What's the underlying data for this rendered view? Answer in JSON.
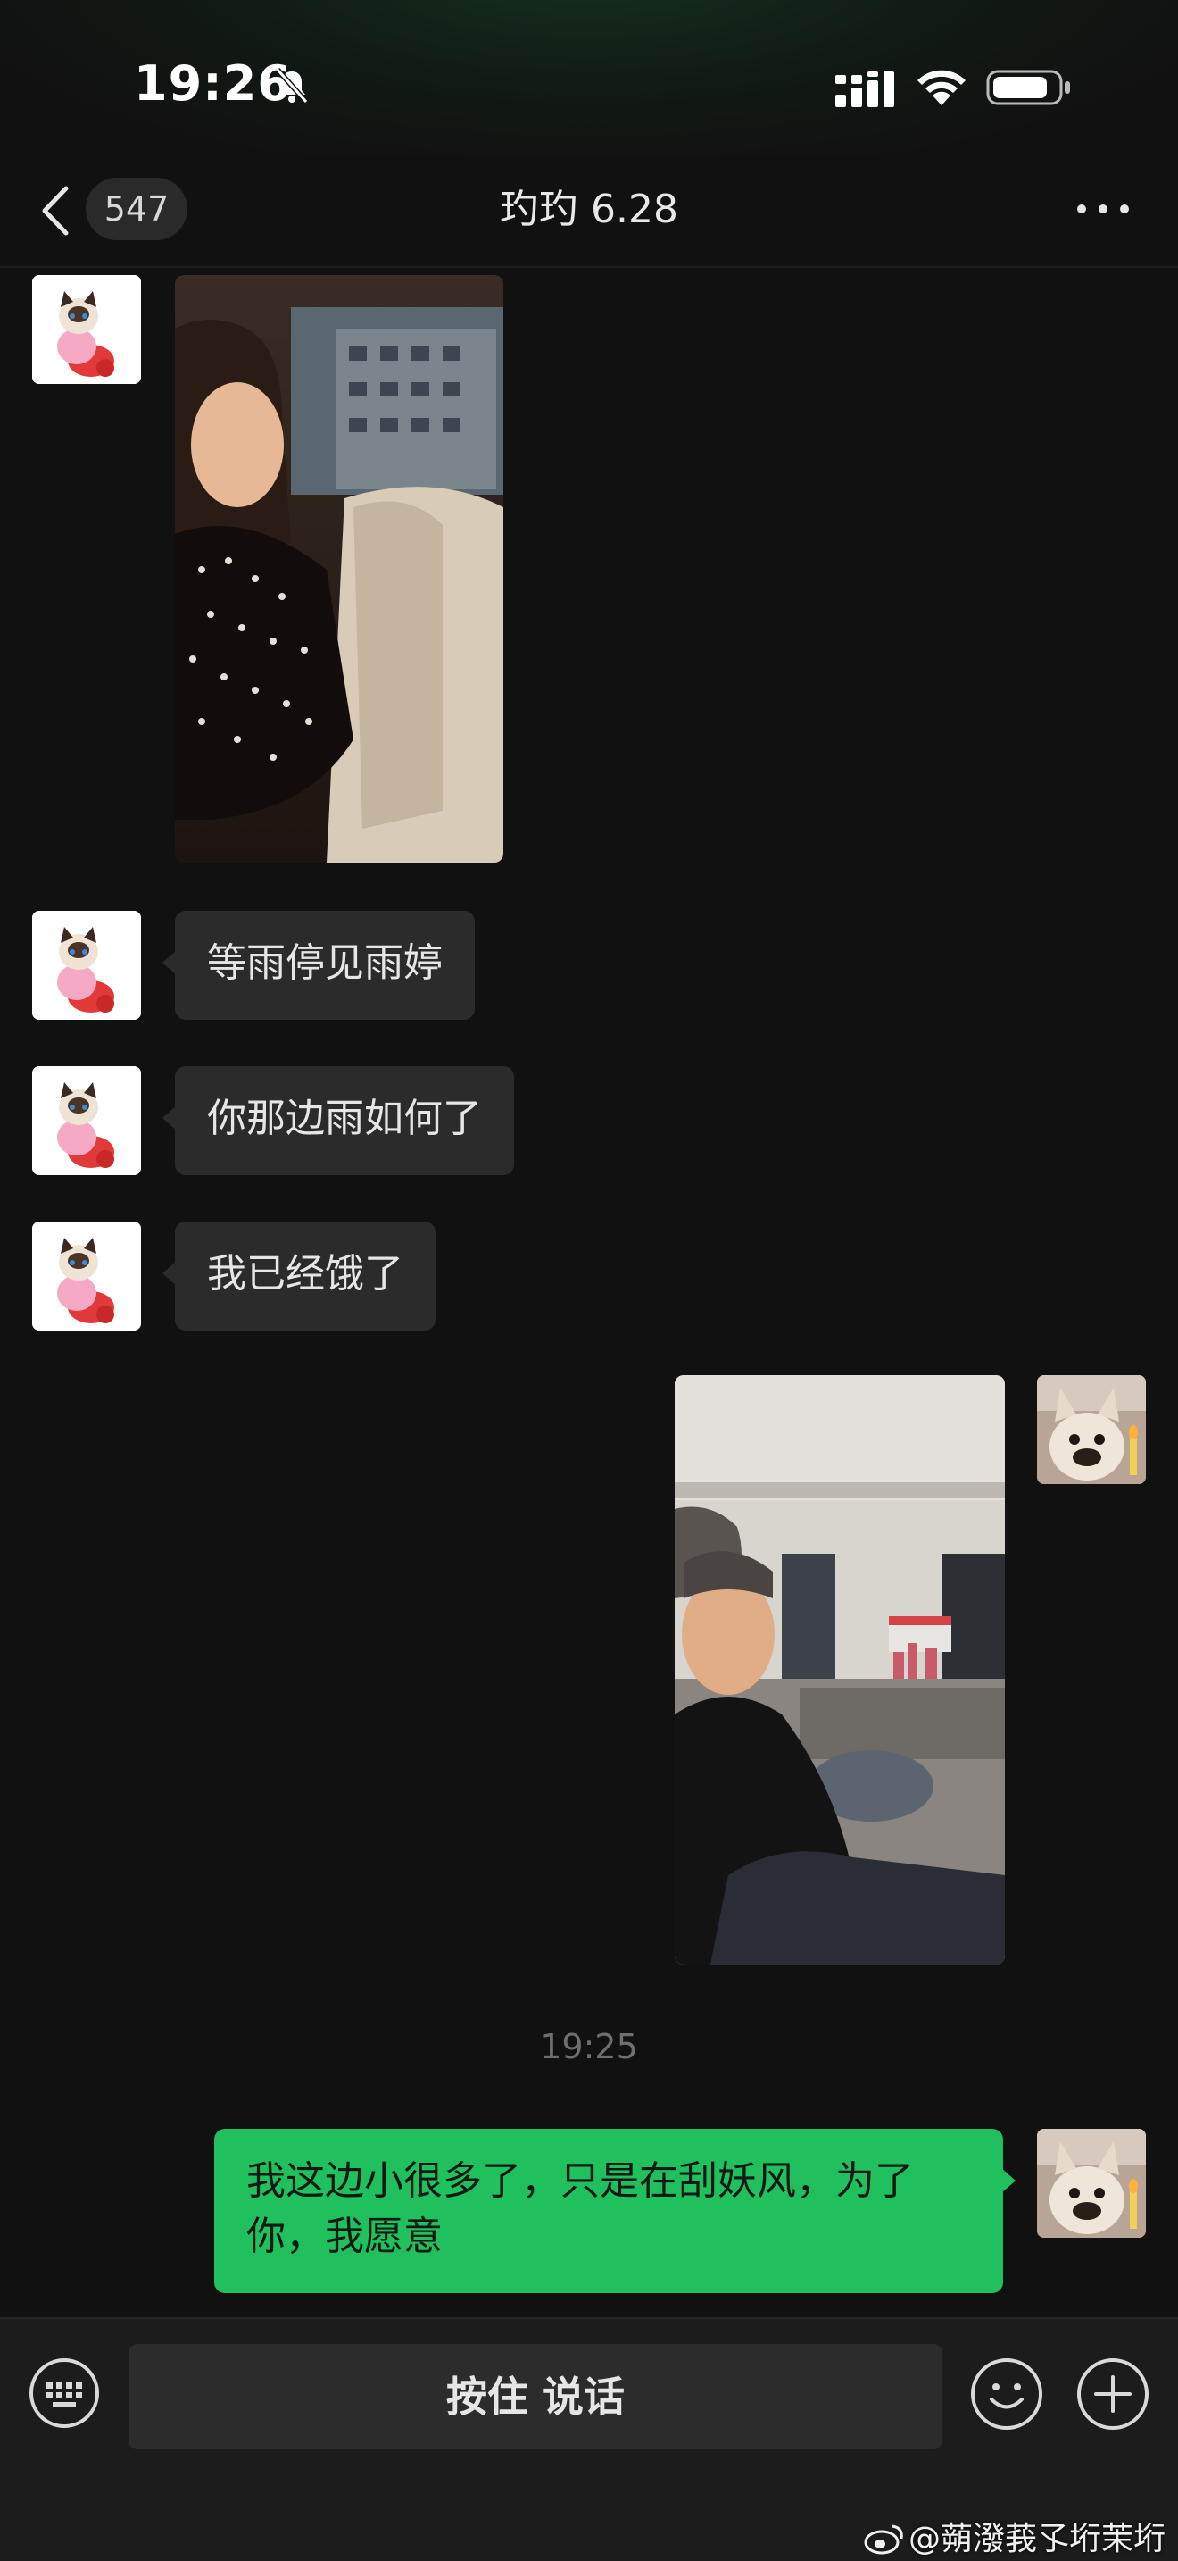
{
  "status_bar": {
    "time": "19:26",
    "icons": [
      "bell-off-icon",
      "signal-icon",
      "wifi-icon",
      "battery-icon"
    ]
  },
  "header": {
    "unread_count": "547",
    "title": "玓玓 6.28",
    "icons": [
      "back-icon",
      "more-icon"
    ]
  },
  "messages": [
    {
      "sender": "contact",
      "type": "image",
      "avatar": "cat-avatar"
    },
    {
      "sender": "contact",
      "type": "text",
      "text": "等雨停见雨婷",
      "avatar": "cat-avatar"
    },
    {
      "sender": "contact",
      "type": "text",
      "text": "你那边雨如何了",
      "avatar": "cat-avatar"
    },
    {
      "sender": "contact",
      "type": "text",
      "text": "我已经饿了",
      "avatar": "cat-avatar"
    },
    {
      "sender": "me",
      "type": "image",
      "avatar": "dog-avatar"
    },
    {
      "type": "timestamp",
      "text": "19:25"
    },
    {
      "sender": "me",
      "type": "text",
      "text": "我这边小很多了，只是在刮妖风，为了你，我愿意",
      "avatar": "dog-avatar"
    }
  ],
  "input_bar": {
    "hold_to_talk_label": "按住 说话",
    "icons": [
      "keyboard-icon",
      "emoji-icon",
      "plus-icon"
    ]
  },
  "watermark": "@蒴潑莪孓垳茉垳",
  "colors": {
    "background": "#111111",
    "incoming_bubble": "#2b2b2b",
    "outgoing_bubble": "#21c05e",
    "input_bar": "#1c1c1c"
  }
}
